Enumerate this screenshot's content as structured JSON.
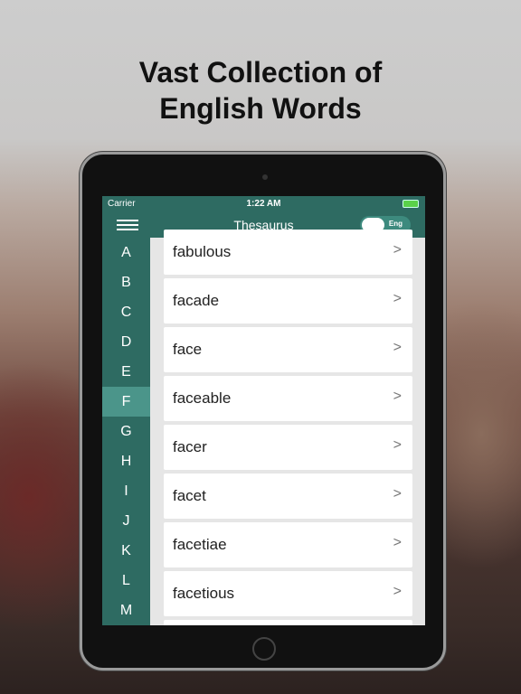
{
  "headline": [
    "Vast Collection of",
    "English Words"
  ],
  "status": {
    "carrier": "Carrier",
    "time": "1:22 AM"
  },
  "header": {
    "title": "Thesaurus",
    "toggle_label": "Eng",
    "toggle_on": false
  },
  "letters": [
    "A",
    "B",
    "C",
    "D",
    "E",
    "F",
    "G",
    "H",
    "I",
    "J",
    "K",
    "L",
    "M"
  ],
  "active_letter": "F",
  "words": [
    "fabulous",
    "facade",
    "face",
    "faceable",
    "facer",
    "facet",
    "facetiae",
    "facetious",
    ""
  ],
  "colors": {
    "primary": "#2e6b62",
    "active": "#4b958a"
  }
}
